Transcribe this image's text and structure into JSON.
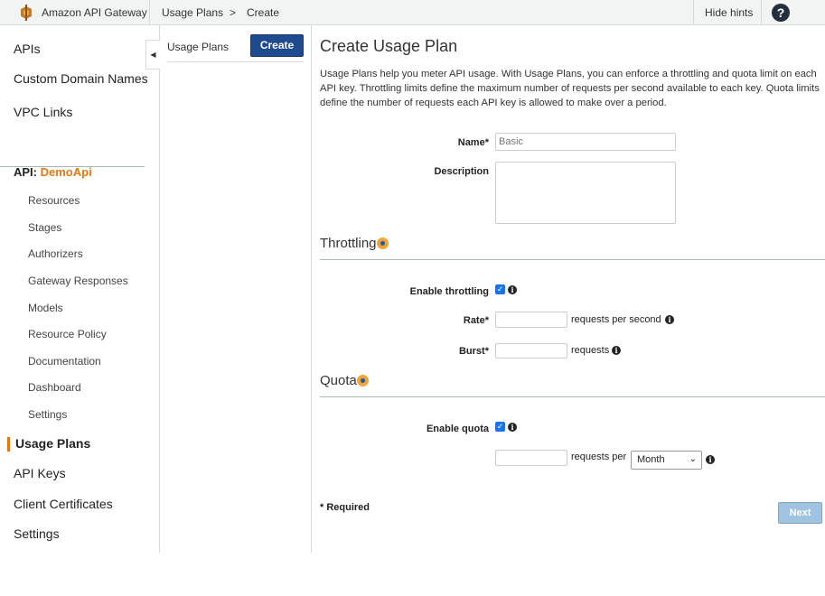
{
  "topbar": {
    "brand": "Amazon API Gateway",
    "breadcrumb": [
      "Usage Plans",
      ">",
      "Create"
    ],
    "hide_hints": "Hide hints",
    "help": "?"
  },
  "leftnav": {
    "top_items": [
      "APIs",
      "Custom Domain Names",
      "VPC Links"
    ],
    "api_prefix": "API:",
    "api_name": "DemoApi",
    "api_items": [
      "Resources",
      "Stages",
      "Authorizers",
      "Gateway Responses",
      "Models",
      "Resource Policy",
      "Documentation",
      "Dashboard",
      "Settings"
    ],
    "bottom_items": [
      "Usage Plans",
      "API Keys",
      "Client Certificates",
      "Settings"
    ],
    "active": "Usage Plans"
  },
  "midcol": {
    "title": "Usage Plans",
    "create_label": "Create"
  },
  "main": {
    "title": "Create Usage Plan",
    "description": "Usage Plans help you meter API usage. With Usage Plans, you can enforce a throttling and quota limit on each API key. Throttling limits define the maximum number of requests per second available to each key. Quota limits define the number of requests each API key is allowed to make over a period.",
    "name_label": "Name*",
    "name_placeholder": "Basic",
    "description_label": "Description",
    "throttling": {
      "heading": "Throttling",
      "enable_label": "Enable throttling",
      "enabled": true,
      "rate_label": "Rate*",
      "rate_suffix": "requests per second",
      "burst_label": "Burst*",
      "burst_suffix": "requests"
    },
    "quota": {
      "heading": "Quota",
      "enable_label": "Enable quota",
      "enabled": true,
      "per_suffix": "requests per",
      "period": "Month"
    },
    "required_note": "* Required",
    "next_label": "Next"
  },
  "colors": {
    "accent_orange": "#e47911",
    "primary_blue": "#1e4b8f",
    "next_disabled": "#9fc3e0"
  }
}
